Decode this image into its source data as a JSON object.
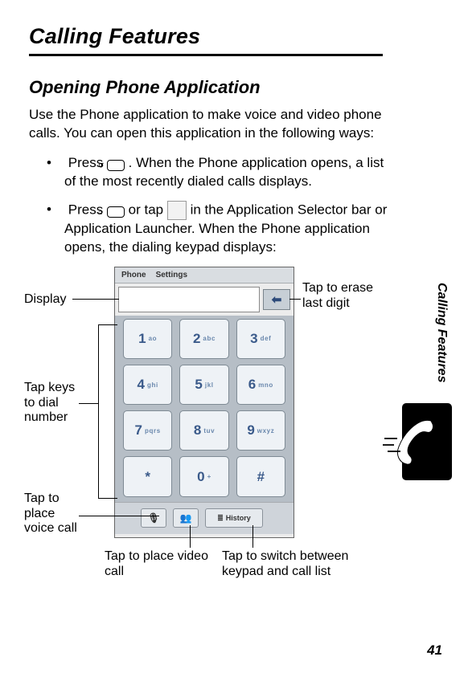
{
  "page": {
    "title": "Calling Features",
    "section": "Opening Phone Application",
    "intro": "Use the Phone application to make voice and video phone calls. You can open this application in the following ways:",
    "bullet1_a": "Press ",
    "bullet1_b": ". When the Phone application opens, a list of the most recently dialed calls displays.",
    "bullet2_a": "Press ",
    "bullet2_b": " or tap ",
    "bullet2_c": " in the Application Selector bar or Application Launcher. When the Phone application opens, the dialing keypad displays:",
    "side_label": "Calling Features",
    "page_number": "41"
  },
  "phone_ui": {
    "menu1": "Phone",
    "menu2": "Settings",
    "erase_arrow": "⬅",
    "keys": [
      {
        "n": "1",
        "s": "ao"
      },
      {
        "n": "2",
        "s": "abc"
      },
      {
        "n": "3",
        "s": "def"
      },
      {
        "n": "4",
        "s": "ghi"
      },
      {
        "n": "5",
        "s": "jkl"
      },
      {
        "n": "6",
        "s": "mno"
      },
      {
        "n": "7",
        "s": "pqrs"
      },
      {
        "n": "8",
        "s": "tuv"
      },
      {
        "n": "9",
        "s": "wxyz"
      },
      {
        "n": "*",
        "s": ""
      },
      {
        "n": "0",
        "s": "+"
      },
      {
        "n": "#",
        "s": ""
      }
    ],
    "voice_icon": "🎙",
    "video_icon": "👥",
    "history_label": "History"
  },
  "callouts": {
    "display": "Display",
    "erase": "Tap to erase last digit",
    "keys": "Tap keys to dial number",
    "voice": "Tap to place voice call",
    "video": "Tap to place video call",
    "history": "Tap to switch between keypad and call list"
  }
}
